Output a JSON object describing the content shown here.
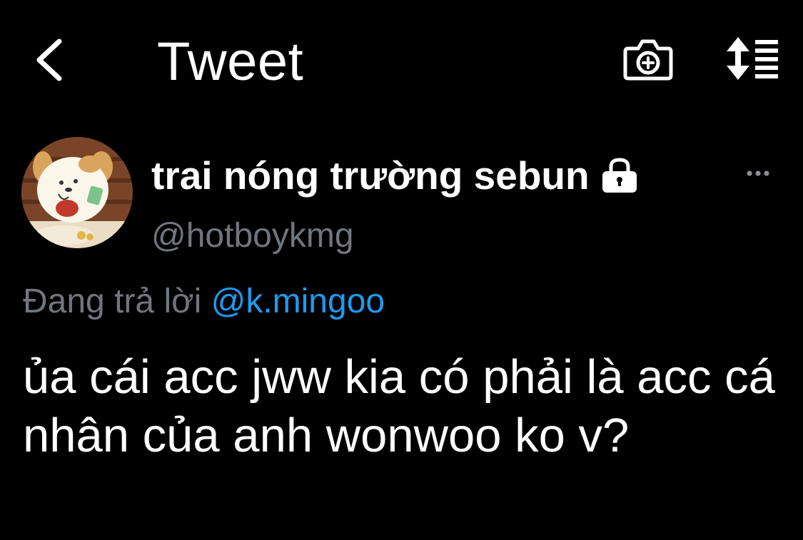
{
  "header": {
    "title": "Tweet",
    "back_icon": "chevron-left-icon",
    "camera_icon": "camera-plus-icon",
    "sort_icon": "sort-list-icon"
  },
  "tweet": {
    "author": {
      "display_name": "trai nóng trường sebun",
      "handle": "@hotboykmg",
      "protected_icon": "lock-icon",
      "avatar_icon": "cartoon-dog-avatar"
    },
    "more_icon": "more-horizontal-icon",
    "reply_context": {
      "prefix": "Đang trả lời",
      "mention": "@k.mingoo"
    },
    "text": "ủa cái acc jww kia có phải là acc cá nhân của anh wonwoo ko v?"
  },
  "colors": {
    "background": "#000000",
    "text_primary": "#ffffff",
    "text_secondary": "#71767b",
    "link": "#1d9bf0"
  }
}
